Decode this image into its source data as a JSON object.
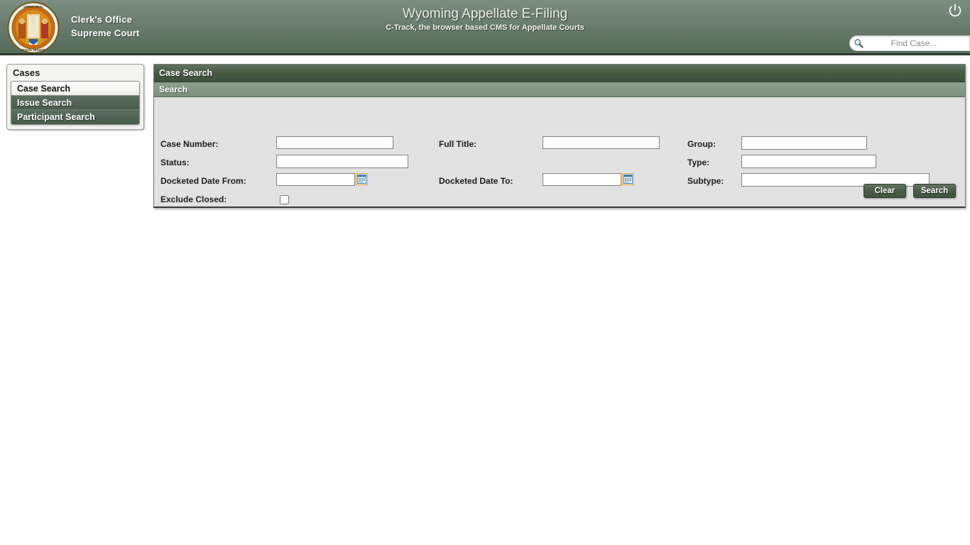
{
  "header": {
    "seal_alt": "wyoming-state-seal",
    "brand_line1": "Clerk's Office",
    "brand_line2": "Supreme Court",
    "title": "Wyoming Appellate E-Filing",
    "subtitle": "C-Track, the browser based CMS for Appellate Courts",
    "power_icon": "power-icon",
    "find_case": {
      "icon": "search-icon",
      "value": "",
      "placeholder": "Find Case..."
    }
  },
  "sidebar": {
    "title": "Cases",
    "items": [
      {
        "label": "Case Search",
        "selected": true
      },
      {
        "label": "Issue Search",
        "selected": false
      },
      {
        "label": "Participant Search",
        "selected": false
      }
    ]
  },
  "panel": {
    "title": "Case Search",
    "section_title": "Search",
    "fields": {
      "case_number": {
        "label": "Case Number:",
        "value": "",
        "placeholder": ""
      },
      "status": {
        "label": "Status:",
        "value": "",
        "options": [
          ""
        ]
      },
      "docketed_date_from": {
        "label": "Docketed Date From:",
        "value": "",
        "placeholder": "",
        "calendar_icon": "calendar-icon"
      },
      "exclude_closed": {
        "label": "Exclude Closed:",
        "checked": false
      },
      "full_title": {
        "label": "Full Title:",
        "value": "",
        "placeholder": ""
      },
      "docketed_date_to": {
        "label": "Docketed Date To:",
        "value": "",
        "placeholder": "",
        "calendar_icon": "calendar-icon"
      },
      "group": {
        "label": "Group:",
        "value": "",
        "options": [
          ""
        ]
      },
      "type": {
        "label": "Type:",
        "value": "",
        "options": [
          ""
        ]
      },
      "subtype": {
        "label": "Subtype:",
        "value": "",
        "options": [
          ""
        ]
      }
    },
    "buttons": {
      "clear": "Clear",
      "search": "Search"
    }
  },
  "colors": {
    "header_green": "#6e8073",
    "panel_title_green": "#46593f",
    "section_green": "#7b8f7c",
    "form_bg": "#e2e2e2",
    "button_green": "#4b5c49",
    "calendar_accent": "#e8a33d"
  }
}
